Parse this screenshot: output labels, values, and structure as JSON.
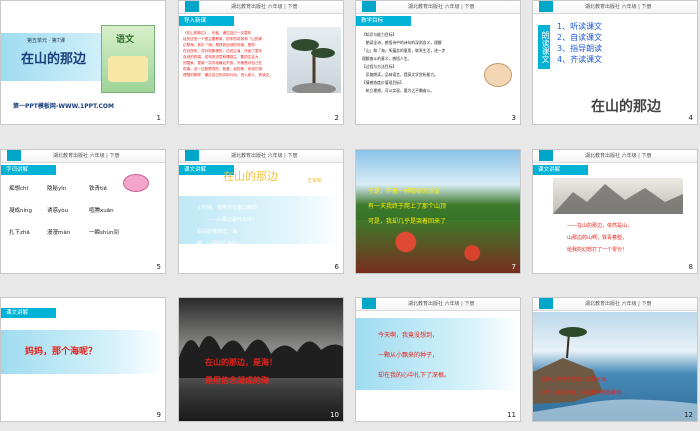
{
  "header_text": "湖北教育出版社 六年级 | 下册",
  "slide_numbers": [
    "1",
    "2",
    "3",
    "4",
    "5",
    "6",
    "7",
    "8",
    "9",
    "10",
    "11",
    "12"
  ],
  "s1": {
    "unit": "第五单元 · 第7课",
    "title": "在山的那边",
    "book": "语文",
    "footer": "第一PPT模板网-WWW.1PPT.COM"
  },
  "s2": {
    "bar": "导入新课",
    "lines": [
      "《在山的那边》，作者，通过自己一次童年",
      "经历过的一个很主要教育，抓牢的将其和「山的那",
      "边是海，其中「海」是抓到自然的领域，是抓",
      "在自然的，并对现象情形，边说主演，作者了童年",
      "自然的终端，成年的进意和情感主，要抓住这大",
      "的国家，更新一次次地最后失败，不便是对自己在",
      "现事，这一过程是同的，勤爱、诚知等，你将们将",
      "理想的那样，通过自己的实际行动，进入奋斗，抓读文。"
    ]
  },
  "s3": {
    "bar": "教学目标",
    "lines": [
      "【知识与能力目标】",
      "　朗读全诗，感悟诗中的诗句的深刻含义，理解",
      "「山」和「海」所蕴含的意思，联系生活，进一步",
      "理解奋斗的意义，感悟人生。",
      "【过程与方法目标】",
      "　反复朗读，品味语言，提高文学赏析能力。",
      "【情感态度价值观目标】",
      "　树立理想，可以实现，要为之不懈奋斗。"
    ]
  },
  "s4": {
    "side": "朗读课文",
    "items": [
      "1、听读课文",
      "2、自读课文",
      "3、指导朗读",
      "4、齐读课文"
    ],
    "title": "在山的那边"
  },
  "s5": {
    "bar": "字词讲解",
    "words": [
      [
        "痴想chī",
        "隐秘yǐn",
        "铁青tiě"
      ],
      [
        "凝成níng",
        "诱惑yòu",
        "喧腾xuān"
      ],
      [
        "扎下zhā",
        "漫漫màn",
        "一瞬shùn间"
      ]
    ]
  },
  "s6": {
    "bar": "课文讲解",
    "title": "在山的那边",
    "author": "王家新",
    "lines": [
      "小时候，我常伏在窗口痴想",
      "——山那边是什么呢？",
      "妈妈给我说过：海",
      "哦，山那边是海吗？"
    ]
  },
  "s7": {
    "lines": [
      "于是，怀着一种隐秘的想望",
      "有一天我终于爬上了那个山顶",
      "可是，我却几乎是哭着回来了"
    ]
  },
  "s8": {
    "bar": "课文讲解",
    "lines": [
      "——在山的那边，依然是山，",
      "山那边的山啊，铁青着脸，",
      "给我的幻想打了一个零分！"
    ]
  },
  "s9": {
    "bar": "课文讲解",
    "text": "妈妈，那个海呢？"
  },
  "s10": {
    "lines": [
      "在山的那边，是海！",
      "是用信念凝成的海"
    ]
  },
  "s11": {
    "lines": [
      "今天啊，我竟没想到，",
      "一颗从小飘来的种子，",
      "却在我的心中扎下了深根。"
    ]
  },
  "s12": {
    "lines": [
      "是的，我终于见到一次跟大海，",
      "这个山那边的海，以后都会激励着我..."
    ]
  },
  "colors": {
    "accent": "#00b3d6",
    "red": "#e8211a",
    "green": "#2e9a3a",
    "blue": "#1a3f7a"
  }
}
